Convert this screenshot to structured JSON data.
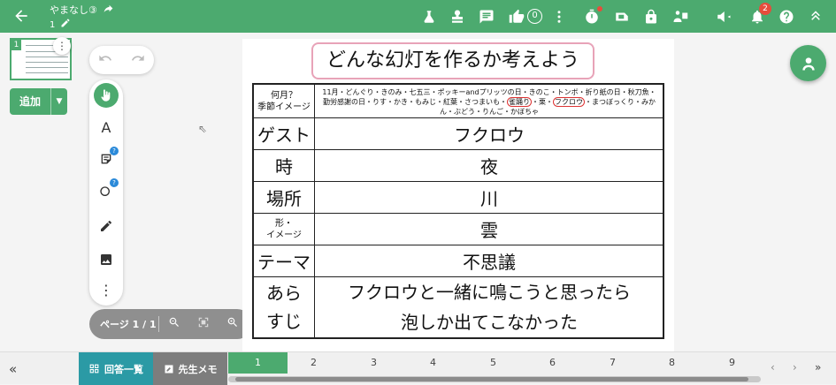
{
  "topbar": {
    "title": "やまなし③",
    "page_label": "1",
    "like_count": "0",
    "notification_count": "2",
    "icons": [
      "back-arrow-icon",
      "edit-icon",
      "share-icon",
      "lab-icon",
      "stamp-icon",
      "comment-icon",
      "thumb-up-icon",
      "more-icon",
      "timer-icon",
      "camera-off-icon",
      "lock-icon",
      "present-icon",
      "megaphone-icon",
      "bell-icon",
      "help-icon",
      "collapse-up-icon"
    ]
  },
  "sidebar": {
    "thumbnail_number": "1",
    "add_button_label": "追加"
  },
  "toolbar": {
    "text_tool_label": "A",
    "tools": [
      "hand-pointer-icon",
      "text-icon",
      "sticky-note-icon",
      "shape-icon",
      "pen-icon",
      "image-icon",
      "more-icon"
    ]
  },
  "page_control": {
    "label": "ページ 1 / 1"
  },
  "worksheet": {
    "heading": "どんな幻灯を作るか考えよう",
    "season_label_line1": "何月？",
    "season_label_line2": "季節イメージ",
    "season_text_1": "11月・どんぐり・きのみ・七五三・ポッキーandプリッツの日・きのこ・トンボ・折り紙の日・秋刀魚・勤労感謝の日・りす・かき・もみじ・紅葉・さつまいも・",
    "season_circled_1": "雀踊り",
    "season_text_2": "・栗・",
    "season_circled_2": "フクロウ",
    "season_text_3": "・まつぼっくり・みかん・ぶどう・りんご・かぼちゃ",
    "rows": [
      {
        "label": "ゲスト",
        "value": "フクロウ"
      },
      {
        "label": "時",
        "value": "夜"
      },
      {
        "label": "場所",
        "value": "川"
      },
      {
        "label": "形・\nイメージ",
        "value": "雲"
      },
      {
        "label": "テーマ",
        "value": "不思議"
      }
    ],
    "story_label_line1": "あら",
    "story_label_line2": "すじ",
    "story_line1": "フクロウと一緒に鳴こうと思ったら",
    "story_line2": "泡しか出てこなかった"
  },
  "bottombar": {
    "answers_label": "回答一覧",
    "memo_label": "先生メモ",
    "pages": [
      "1",
      "2",
      "3",
      "4",
      "5",
      "6",
      "7",
      "8",
      "9"
    ],
    "selected_page": "1"
  },
  "colors": {
    "brand_green": "#4caa6f",
    "teal": "#2b9aa5",
    "badge_red": "#e74c3c",
    "heading_border_pink": "#e8a3b8"
  }
}
